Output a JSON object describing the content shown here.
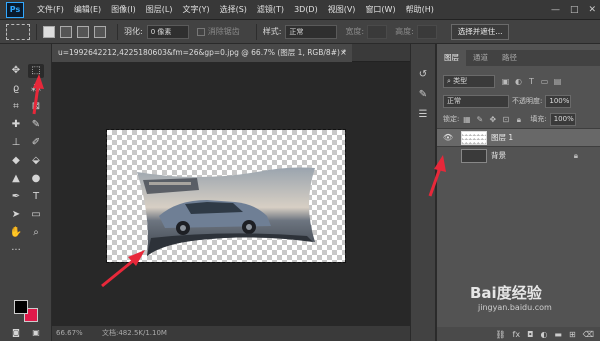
{
  "menubar": {
    "logo": "Ps",
    "items": [
      "文件(F)",
      "编辑(E)",
      "图像(I)",
      "图层(L)",
      "文字(Y)",
      "选择(S)",
      "滤镜(T)",
      "3D(D)",
      "视图(V)",
      "窗口(W)",
      "帮助(H)"
    ],
    "minimize": "—",
    "maximize": "□",
    "close": "✕"
  },
  "optionsbar": {
    "feather_label": "羽化:",
    "feather_value": "0 像素",
    "antialias_label": "消除锯齿",
    "style_label": "样式:",
    "style_value": "正常",
    "width_label": "宽度:",
    "height_label": "高度:",
    "select_mask_button": "选择并遮住..."
  },
  "document": {
    "tab_title": "u=1992642212,4225180603&fm=26&gp=0.jpg @ 66.7% (图层 1, RGB/8#) *",
    "tab_close": "×",
    "zoom": "66.67%",
    "doc_size": "文档:482.5K/1.10M"
  },
  "layers_panel": {
    "tabs": [
      "图层",
      "通道",
      "路径"
    ],
    "filter_kind": "类型",
    "blend_mode": "正常",
    "opacity_label": "不透明度:",
    "opacity_value": "100%",
    "lock_label": "锁定:",
    "fill_label": "填充:",
    "fill_value": "100%",
    "layers": [
      {
        "name": "图层 1",
        "selected": true,
        "visible": true
      },
      {
        "name": "背景",
        "selected": false,
        "visible": false,
        "locked": true
      }
    ]
  },
  "watermark": {
    "brand": "Bai度经验",
    "url": "jingyan.baidu.com"
  },
  "colors": {
    "foreground": "#000000",
    "background": "#e0194a",
    "arrow": "#e8283a"
  }
}
